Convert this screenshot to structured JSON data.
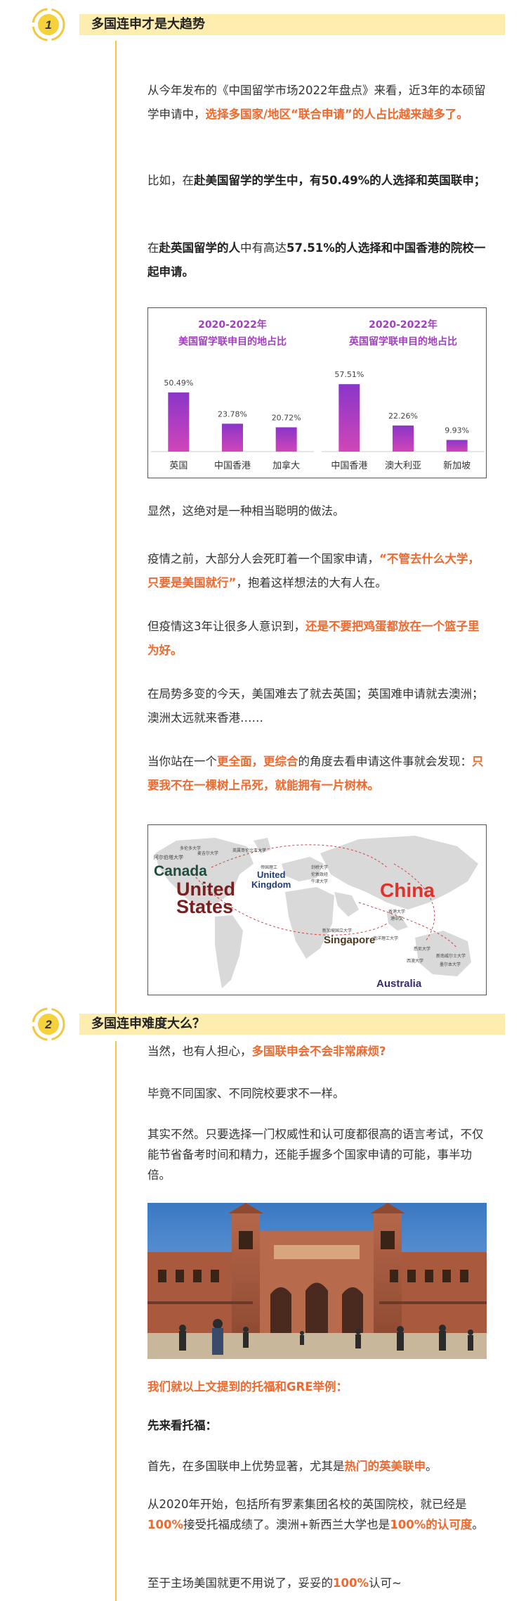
{
  "section1": {
    "number": "1",
    "title": "多国连申才是大趋势",
    "p1": {
      "a": "从今年发布的《中国留学市场2022年盘点》来看，近3年的本硕留学申请中，",
      "b": "选择多国家/地区“联合申请”的人占比越来越多了。"
    },
    "p2": {
      "a": "比如，在",
      "b": "赴美国留学的学生中，有50.49%的人选择和英国联申；"
    },
    "p3": {
      "a": "在",
      "b": "赴英国留学的人",
      "c": "中有高达",
      "d": "57.51%的人选择和中国香港的院校一起申请。"
    },
    "p4": "显然，这绝对是一种相当聪明的做法。",
    "p5": {
      "a": "疫情之前，大部分人会死盯着一个国家申请，",
      "b": "“不管去什么大学，只要是美国就行”",
      "c": "，抱着这样想法的大有人在。"
    },
    "p6": {
      "a": "但疫情这3年让很多人意识到，",
      "b": "还是不要把鸡蛋都放在一个篮子里为好。"
    },
    "p7": "在局势多变的今天，美国难去了就去英国；英国难申请就去澳洲；澳洲太远就来香港……",
    "p8": {
      "a": "当你站在一个",
      "b": "更全面",
      "c": "，",
      "d": "更综合",
      "e": "的角度去看申请这件事就会发现：",
      "f": "只要我不在一棵树上吊死，就能拥有一片树林。"
    }
  },
  "chart_data": [
    {
      "type": "bar",
      "title": "2020-2022年",
      "subtitle": "美国留学联申目的地占比",
      "categories": [
        "英国",
        "中国香港",
        "加拿大"
      ],
      "values": [
        50.49,
        23.78,
        20.72
      ],
      "value_labels": [
        "50.49%",
        "23.78%",
        "20.72%"
      ],
      "ylim": [
        0,
        60
      ],
      "grid": false
    },
    {
      "type": "bar",
      "title": "2020-2022年",
      "subtitle": "英国留学联申目的地占比",
      "categories": [
        "中国香港",
        "澳大利亚",
        "新加坡"
      ],
      "values": [
        57.51,
        22.26,
        9.93
      ],
      "value_labels": [
        "57.51%",
        "22.26%",
        "9.93%"
      ],
      "ylim": [
        0,
        60
      ],
      "grid": false
    }
  ],
  "map": {
    "labels": {
      "canada": "Canada",
      "usa_1": "United",
      "usa_2": "States",
      "uk_1": "United",
      "uk_2": "Kingdom",
      "china": "China",
      "singapore": "Singapore",
      "australia": "Australia"
    },
    "colors": {
      "canada": "#1f4c3e",
      "usa": "#7a1f1f",
      "uk": "#1f3d7a",
      "china": "#e0322c",
      "singapore": "#4a3a1f",
      "australia": "#3a2a6a",
      "route": "#d24040"
    }
  },
  "section2": {
    "number": "2",
    "title": "多国连申难度大么？",
    "p1": {
      "a": "当然，也有人担心，",
      "b": "多国联申会不会非常麻烦?"
    },
    "p2": "毕竟不同国家、不同院校要求不一样。",
    "p3": "其实不然。只要选择一门权威性和认可度都很高的语言考试，不仅能节省备考时间和精力，还能手握多个国家申请的可能，事半功倍。",
    "p4": "我们就以上文提到的托福和GRE举例：",
    "p5": "先来看托福：",
    "p6": {
      "a": "首先，在多国联申上优势显著，尤其是",
      "b": "热门的英美联申",
      "c": "。"
    },
    "p7": {
      "a": "从2020年开始，包括所有罗素集团名校的英国院校，就已经是",
      "b": "100%",
      "c": "接受托福成绩了。澳洲+新西兰大学也是",
      "d": "100%的认可度",
      "e": "。"
    },
    "p8": {
      "a": "至于主场美国就更不用说了，妥妥的",
      "b": "100%",
      "c": "认可~"
    }
  },
  "colors": {
    "accent": "#f0692e",
    "band": "#fdeeb0",
    "line": "#f3c73f",
    "title_purple": "#a23fbf"
  }
}
